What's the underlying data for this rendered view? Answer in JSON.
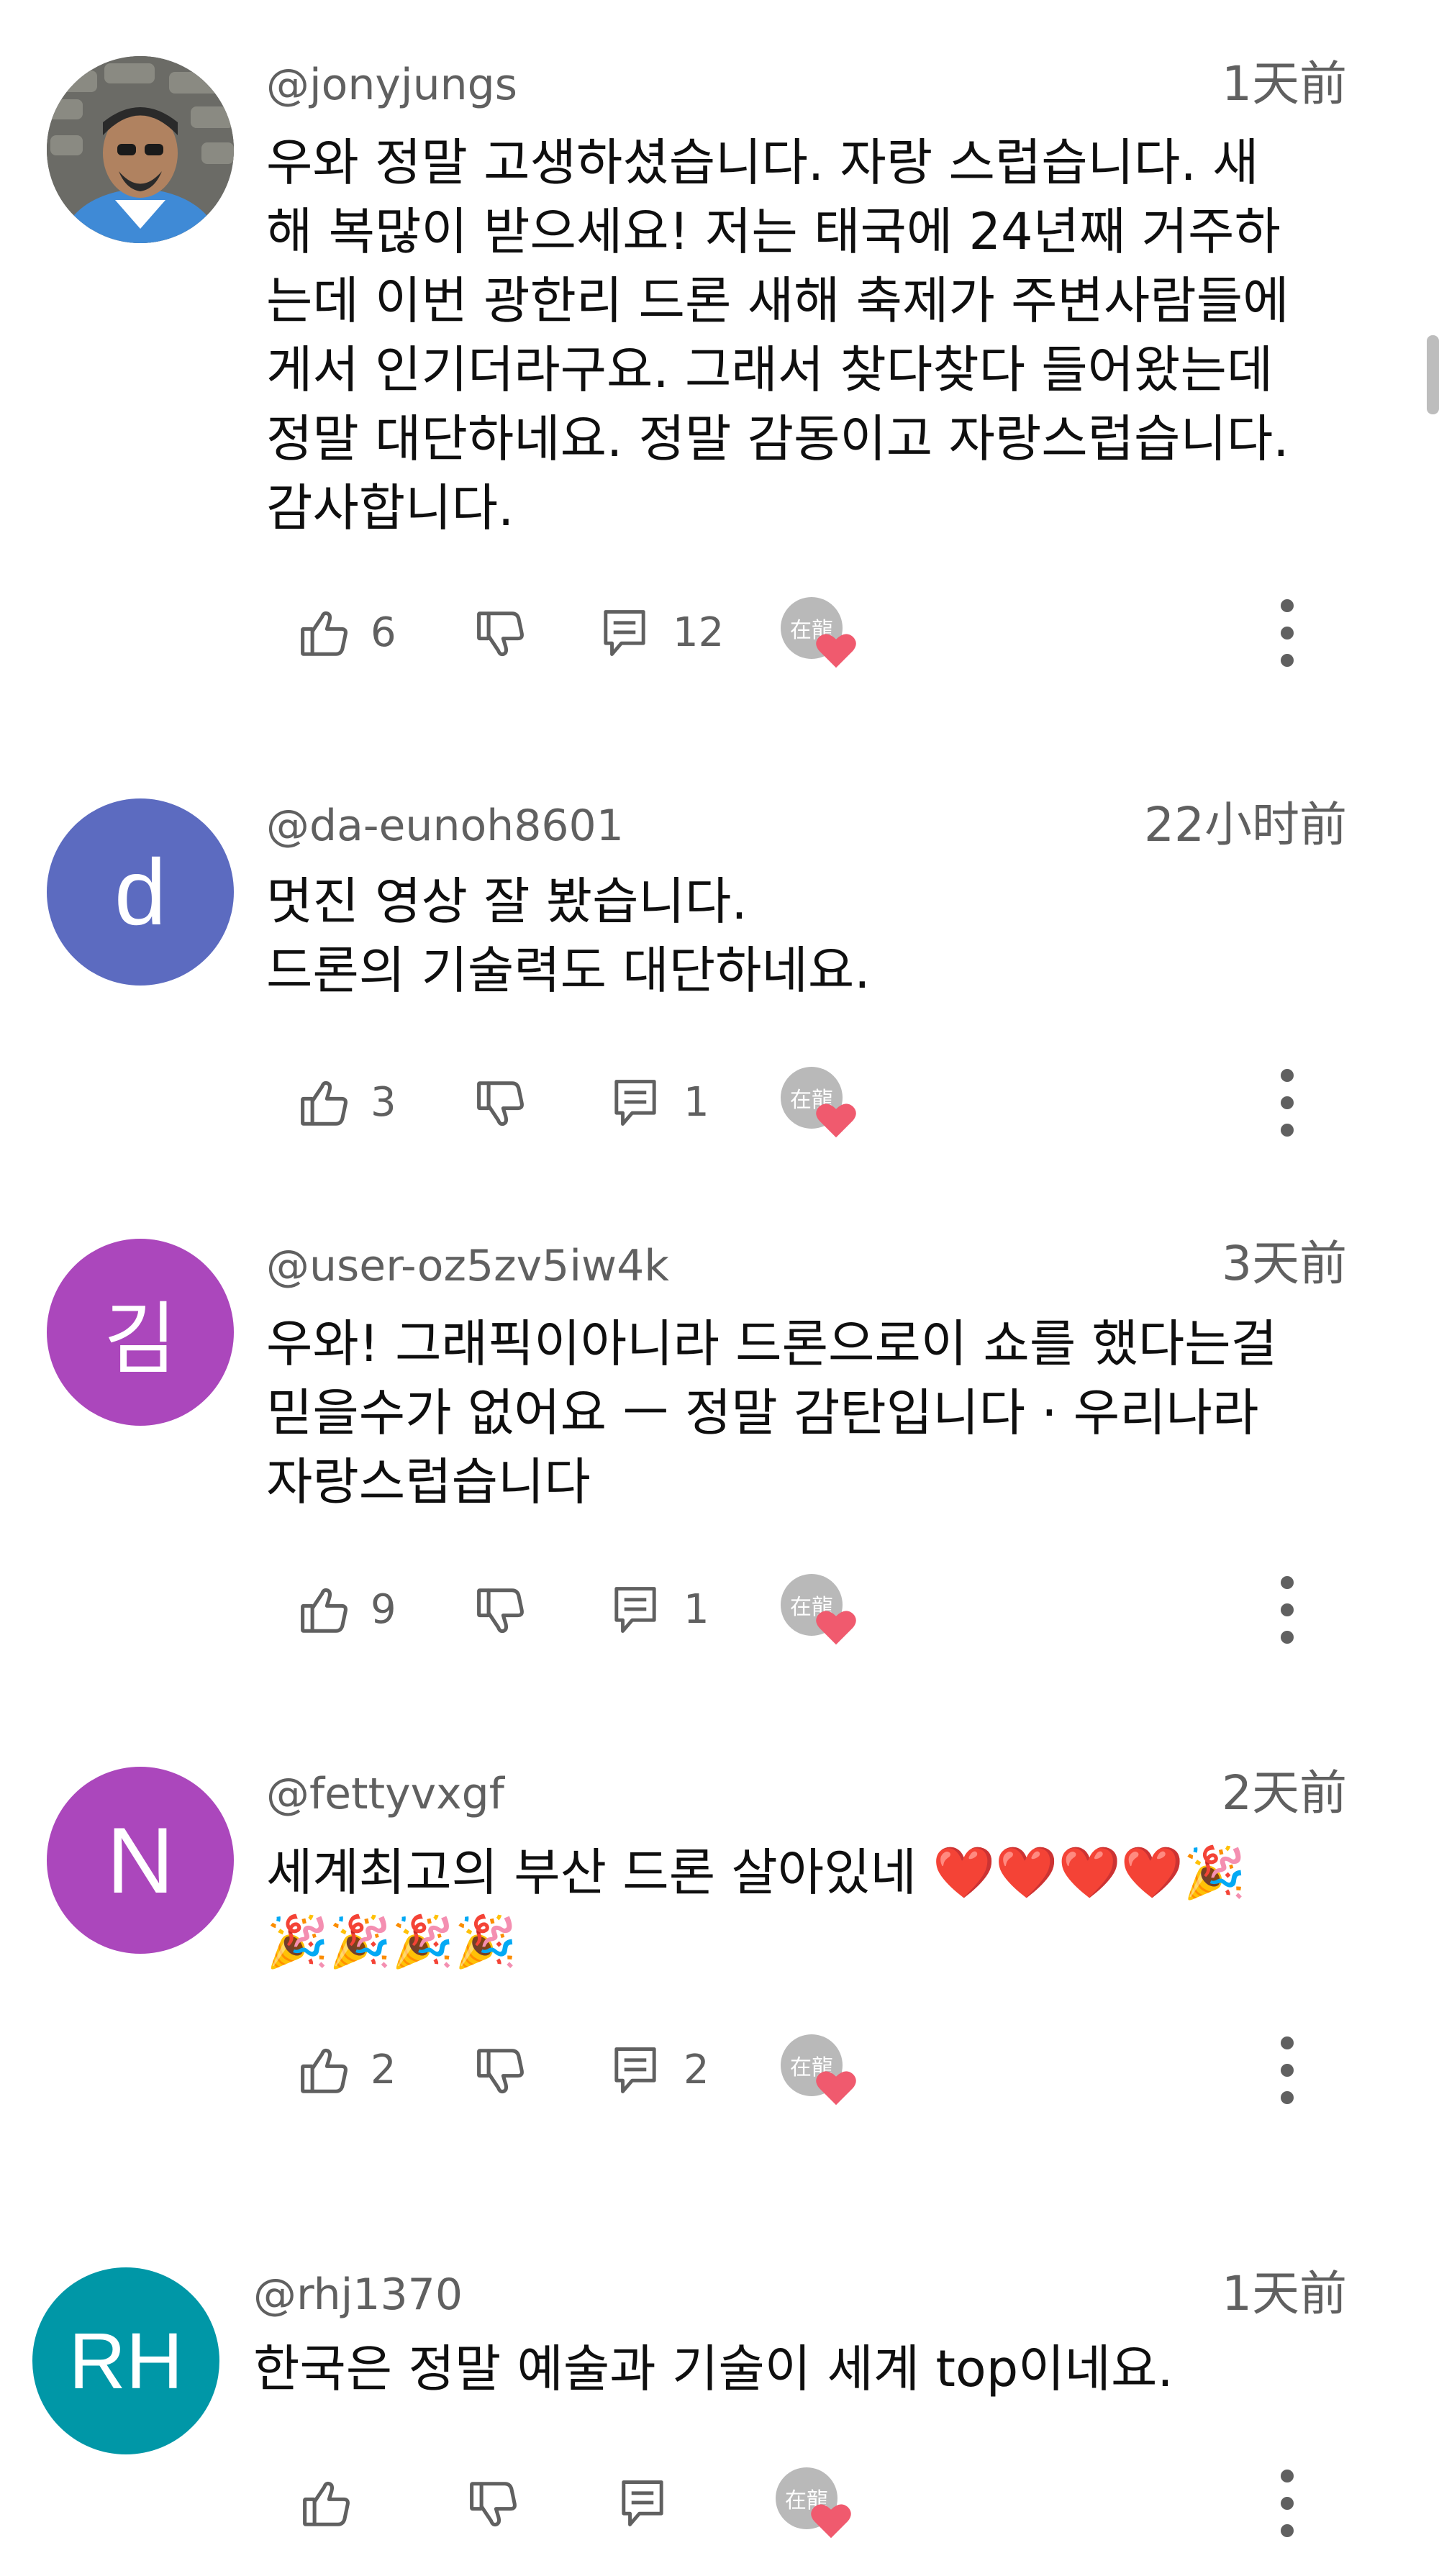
{
  "comments": [
    {
      "username": "@jonyjungs",
      "time": "1天前",
      "avatar": {
        "type": "photo",
        "color": "#5b5b5b"
      },
      "lines": [
        "우와 정말 고생하셨습니다. 자랑 스럽습니다. 새",
        "해 복많이 받으세요!  저는 태국에 24년째 거주하",
        "는데 이번 광한리 드론 새해 축제가 주변사람들에",
        "게서 인기더라구요. 그래서 찾다찾다 들어왔는데",
        "정말 대단하네요. 정말 감동이고 자랑스럽습니다.",
        "감사합니다."
      ],
      "likes": "6",
      "replies": "12"
    },
    {
      "username": "@da-eunoh8601",
      "time": "22小时前",
      "avatar": {
        "type": "letter",
        "letter": "d",
        "color": "#5c6bc0"
      },
      "lines": [
        "멋진 영상 잘 봤습니다.",
        "드론의 기술력도 대단하네요."
      ],
      "likes": "3",
      "replies": "1"
    },
    {
      "username": "@user-oz5zv5iw4k",
      "time": "3天前",
      "avatar": {
        "type": "letter",
        "letter": "김",
        "color": "#ab47bc"
      },
      "lines": [
        "우와! 그래픽이아니라 드론으로이 쇼를 했다는걸",
        "믿을수가 없어요 ㅡ 정말 감탄입니다  ·  우리나라",
        "자랑스럽습니다"
      ],
      "likes": "9",
      "replies": "1"
    },
    {
      "username": "@fettyvxgf",
      "time": "2天前",
      "avatar": {
        "type": "letter",
        "letter": "N",
        "color": "#ab47bc"
      },
      "lines": [
        "세계최고의 부산 드론 살아있네 ❤️❤️❤️❤️🎉",
        "🎉🎉🎉🎉"
      ],
      "likes": "2",
      "replies": "2"
    },
    {
      "username": "@rhj1370",
      "time": "1天前",
      "avatar": {
        "type": "letter",
        "letter": "RH",
        "color": "#0097a7"
      },
      "lines": [
        "한국은 정말 예술과 기술이 세계 top이네요."
      ],
      "likes": "",
      "replies": ""
    }
  ],
  "creator_badge": {
    "label": "在龍",
    "heart_color": "#f05a6e"
  },
  "icons": [
    "thumb-up-icon",
    "thumb-down-icon",
    "reply-icon",
    "creator-heart-icon",
    "more-vert-icon"
  ]
}
